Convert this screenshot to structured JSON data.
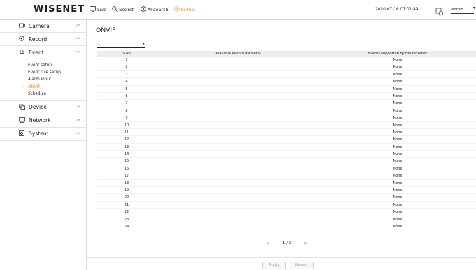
{
  "app": {
    "logo": "WISENET"
  },
  "topnav": [
    {
      "label": "Live",
      "icon": "monitor-icon",
      "active": false
    },
    {
      "label": "Search",
      "icon": "search-icon",
      "active": false
    },
    {
      "label": "AI search",
      "icon": "ai-search-icon",
      "active": false
    },
    {
      "label": "Setup",
      "icon": "gear-icon",
      "active": true
    }
  ],
  "header": {
    "datetime": "2020-07-16 07:01:49",
    "user": "admin"
  },
  "sidebar": {
    "sections": [
      {
        "label": "Camera",
        "icon": "camera-icon",
        "expanded": false
      },
      {
        "label": "Record",
        "icon": "record-icon",
        "expanded": false
      },
      {
        "label": "Event",
        "icon": "event-icon",
        "expanded": true,
        "items": [
          {
            "label": "Event setup",
            "active": false
          },
          {
            "label": "Event rule setup",
            "active": false
          },
          {
            "label": "Alarm input",
            "active": false
          },
          {
            "label": "ONVIF",
            "active": true
          },
          {
            "label": "Schedule",
            "active": false
          }
        ]
      },
      {
        "label": "Device",
        "icon": "device-icon",
        "expanded": false
      },
      {
        "label": "Network",
        "icon": "network-icon",
        "expanded": false
      },
      {
        "label": "System",
        "icon": "system-icon",
        "expanded": false
      }
    ]
  },
  "main": {
    "title": "ONVIF",
    "channel_select": {
      "value": "-"
    },
    "table": {
      "headers": [
        "S.No",
        "Available events (camera)",
        "Events supported by the recorder"
      ],
      "rows": [
        [
          "1",
          "",
          "None"
        ],
        [
          "2",
          "",
          "None"
        ],
        [
          "3",
          "",
          "None"
        ],
        [
          "4",
          "",
          "None"
        ],
        [
          "5",
          "",
          "None"
        ],
        [
          "6",
          "",
          "None"
        ],
        [
          "7",
          "",
          "None"
        ],
        [
          "8",
          "",
          "None"
        ],
        [
          "9",
          "",
          "None"
        ],
        [
          "10",
          "",
          "None"
        ],
        [
          "11",
          "",
          "None"
        ],
        [
          "12",
          "",
          "None"
        ],
        [
          "13",
          "",
          "None"
        ],
        [
          "14",
          "",
          "None"
        ],
        [
          "15",
          "",
          "None"
        ],
        [
          "16",
          "",
          "None"
        ],
        [
          "17",
          "",
          "None"
        ],
        [
          "18",
          "",
          "None"
        ],
        [
          "19",
          "",
          "None"
        ],
        [
          "20",
          "",
          "None"
        ],
        [
          "21",
          "",
          "None"
        ],
        [
          "22",
          "",
          "None"
        ],
        [
          "23",
          "",
          "None"
        ],
        [
          "24",
          "",
          "None"
        ]
      ]
    },
    "pagination": {
      "text": "1 / 3",
      "prev": "<",
      "next": ">"
    },
    "buttons": {
      "apply": "Apply",
      "revert": "Revert"
    }
  },
  "colors": {
    "accent": "#f0892e",
    "header_bg": "#ededed",
    "border": "#d9d9d9"
  }
}
